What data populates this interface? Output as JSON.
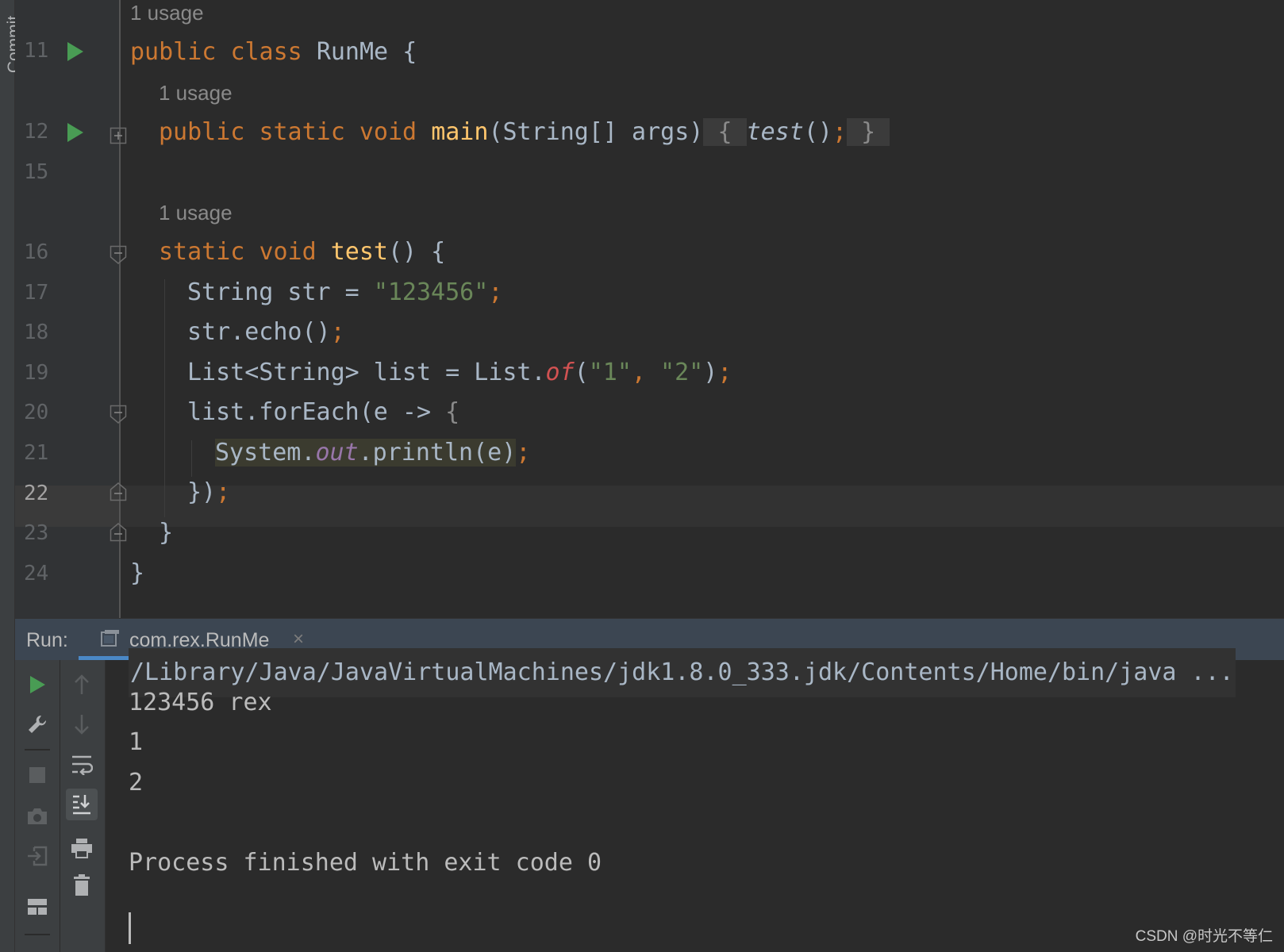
{
  "sidebar": {
    "commit_label": "Commit"
  },
  "editor": {
    "lines": {
      "l11": "11",
      "l12": "12",
      "l15": "15",
      "l16": "16",
      "l17": "17",
      "l18": "18",
      "l19": "19",
      "l20": "20",
      "l21": "21",
      "l22": "22",
      "l23": "23",
      "l24": "24"
    },
    "usages": {
      "class": "1 usage",
      "main": "1 usage",
      "test": "1 usage"
    },
    "code": {
      "l11_kw1": "public",
      "l11_kw2": "class",
      "l11_name": "RunMe",
      "l11_brace": "{",
      "l12_kw1": "public",
      "l12_kw2": "static",
      "l12_kw3": "void",
      "l12_fn": "main",
      "l12_params": "(String[] args)",
      "l12_open": "{",
      "l12_call": "test",
      "l12_paren": "()",
      "l12_semi": ";",
      "l12_close": "}",
      "l16_kw1": "static",
      "l16_kw2": "void",
      "l16_fn": "test",
      "l16_rest": "() {",
      "l17_pre": "String str = ",
      "l17_str": "\"123456\"",
      "l17_semi": ";",
      "l18_pre": "str.echo()",
      "l18_semi": ";",
      "l19_pre": "List<String> list = List.",
      "l19_of": "of",
      "l19_open": "(",
      "l19_s1": "\"1\"",
      "l19_comma": ", ",
      "l19_s2": "\"2\"",
      "l19_close": ")",
      "l19_semi": ";",
      "l20_pre": "list.forEach(e -> ",
      "l20_brace": "{",
      "l21_sys": "System.",
      "l21_out": "out",
      "l21_rest": ".println(e)",
      "l21_semi": ";",
      "l22_pre": "})",
      "l22_semi": ";",
      "l23": "}",
      "l24": "}"
    }
  },
  "run_panel": {
    "label": "Run:",
    "tab_label": "com.rex.RunMe",
    "tab_close": "×",
    "output": [
      "/Library/Java/JavaVirtualMachines/jdk1.8.0_333.jdk/Contents/Home/bin/java ...",
      "123456 rex",
      "1",
      "2",
      "Process finished with exit code 0"
    ]
  },
  "watermark": "CSDN @时光不等仁",
  "colors": {
    "keyword": "#cc7832",
    "function": "#ffc66d",
    "string": "#6a8759",
    "field": "#9876aa",
    "text": "#a9b7c6",
    "run_green": "#499c54",
    "tab_accent": "#4a88c7"
  },
  "icons": [
    "run-icon",
    "rerun-icon",
    "wrench-icon",
    "stop-icon",
    "camera-icon",
    "login-icon",
    "layout-icon",
    "up-arrow-icon",
    "down-arrow-icon",
    "soft-wrap-icon",
    "scroll-to-end-icon",
    "print-icon",
    "trash-icon"
  ]
}
